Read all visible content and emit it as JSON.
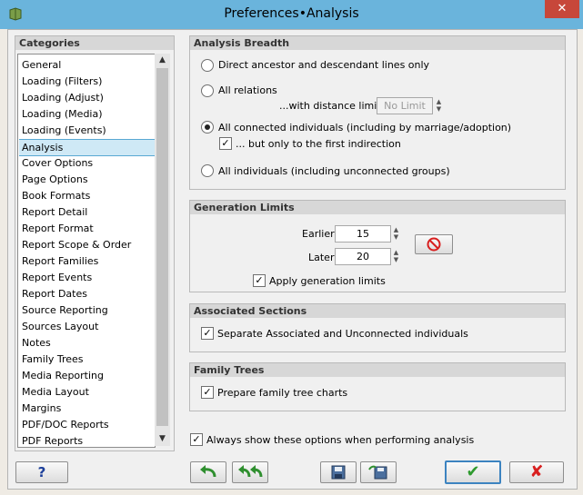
{
  "window": {
    "title": "Preferences•Analysis",
    "close_glyph": "✕"
  },
  "categories": {
    "header": "Categories",
    "items": [
      "General",
      "Loading (Filters)",
      "Loading (Adjust)",
      "Loading (Media)",
      "Loading (Events)",
      "Analysis",
      "Cover Options",
      "Page Options",
      "Book Formats",
      "Report Detail",
      "Report Format",
      "Report Scope & Order",
      "Report Families",
      "Report Events",
      "Report Dates",
      "Source Reporting",
      "Sources Layout",
      "Notes",
      "Family Trees",
      "Media Reporting",
      "Media Layout",
      "Margins",
      "PDF/DOC Reports",
      "PDF Reports"
    ],
    "selected": "Analysis"
  },
  "analysis_breadth": {
    "header": "Analysis Breadth",
    "opt_direct": "Direct ancestor and descendant lines only",
    "opt_all_relations": "All relations",
    "distance_label": "...with distance limit:",
    "distance_value": "No Limit",
    "opt_connected": "All connected individuals (including by marriage/adoption)",
    "first_indirection": "... but only to the first indirection",
    "opt_all_individuals": "All  individuals (including unconnected groups)",
    "selected_option": "All connected individuals (including by marriage/adoption)"
  },
  "generation_limits": {
    "header": "Generation Limits",
    "earlier_label": "Earlier:",
    "earlier_value": "15",
    "later_label": "Later:",
    "later_value": "20",
    "apply": "Apply generation limits",
    "reset_icon": "no-entry-icon"
  },
  "associated_sections": {
    "header": "Associated Sections",
    "separate": "Separate Associated and Unconnected individuals"
  },
  "family_trees": {
    "header": "Family Trees",
    "prepare": "Prepare family tree charts"
  },
  "always_show": "Always show these options when performing analysis",
  "buttons": {
    "help": "?",
    "ok_glyph": "✔",
    "cancel_glyph": "✘"
  },
  "colors": {
    "titlebar": "#6ab4dc",
    "selection": "#cfe9f6",
    "ok_green": "#2e9a2e",
    "cancel_red": "#d81f1f",
    "undo_green": "#2f8f2f"
  }
}
